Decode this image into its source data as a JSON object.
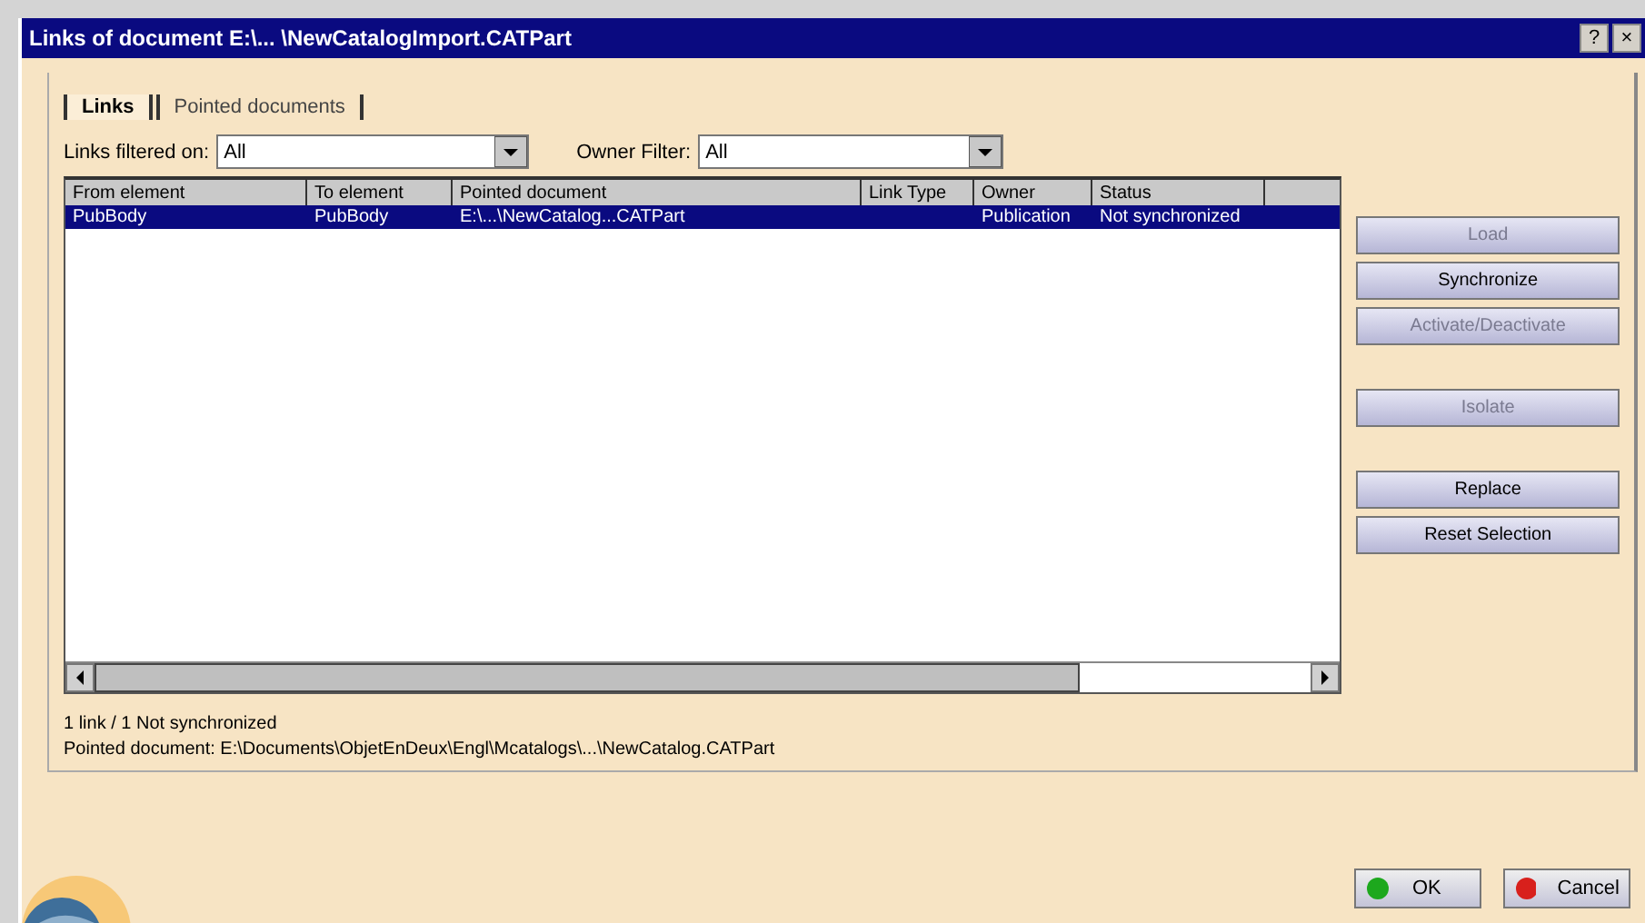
{
  "window": {
    "title": "Links of document E:\\... \\NewCatalogImport.CATPart"
  },
  "title_buttons": [
    "?",
    "×"
  ],
  "tabs": [
    {
      "label": "Links",
      "selected": true
    },
    {
      "label": "Pointed documents",
      "selected": false
    }
  ],
  "filters": [
    {
      "label": "Links filtered on:",
      "value": "All"
    },
    {
      "label": "Owner Filter:",
      "value": "All"
    }
  ],
  "table": {
    "columns": [
      "From element",
      "To element",
      "Pointed document",
      "Link Type",
      "Owner",
      "Status"
    ],
    "rows": [
      {
        "cells": [
          "PubBody",
          "PubBody",
          "E:\\...\\NewCatalog...CATPart",
          "",
          "Publication",
          "Not synchronized"
        ],
        "selected": true
      }
    ]
  },
  "side_buttons": [
    {
      "label": "Load",
      "disabled": true
    },
    {
      "label": "Synchronize",
      "disabled": false
    },
    {
      "label": "Activate/Deactivate",
      "disabled": true
    },
    {
      "label": "Isolate",
      "disabled": true
    },
    {
      "label": "Replace",
      "disabled": false
    },
    {
      "label": "Reset Selection",
      "disabled": false
    }
  ],
  "status_lines": [
    "1 link / 1 Not synchronized",
    "Pointed document: E:\\Documents\\ObjetEnDeux\\Engl\\Mcatalogs\\...\\NewCatalog.CATPart"
  ],
  "dialog_buttons": [
    {
      "label": "OK",
      "kind": "ok"
    },
    {
      "label": "Cancel",
      "kind": "cancel"
    }
  ]
}
